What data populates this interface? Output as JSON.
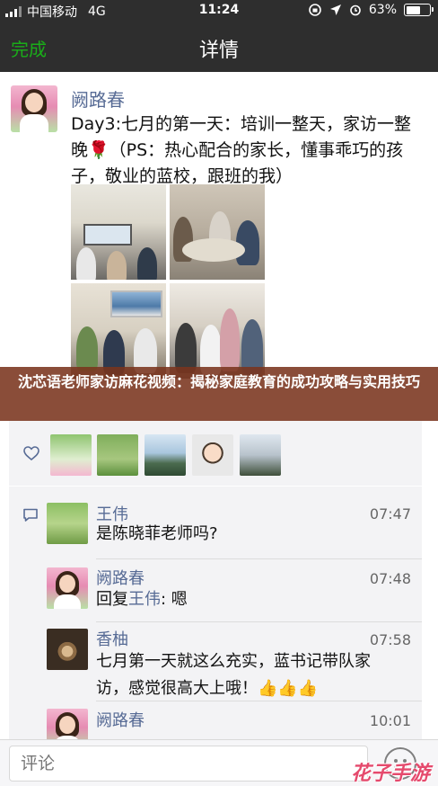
{
  "status_bar": {
    "carrier": "中国移动",
    "network": "4G",
    "time": "11:24",
    "battery_percent_label": "63%",
    "battery_level": 0.63
  },
  "nav": {
    "done_label": "完成",
    "title": "详情"
  },
  "post": {
    "author": "阙路春",
    "text": "Day3:七月的第一天：培训一整天，家访一整晚🌹（PS：热心配合的家长，懂事乖巧的孩子，敬业的蓝校，跟班的我）"
  },
  "banner": {
    "text": "沈芯语老师家访麻花视频：揭秘家庭教育的成功攻略与实用技巧"
  },
  "comments": [
    {
      "author": "王伟",
      "time": "07:47",
      "text": "是陈晓菲老师吗?"
    },
    {
      "author": "阙路春",
      "time": "07:48",
      "reply_prefix": "回复",
      "reply_to": "王伟",
      "text": ": 嗯"
    },
    {
      "author": "香柚",
      "time": "07:58",
      "text": "七月第一天就这么充实，蓝书记带队家访，感觉很高大上哦！👍👍👍"
    },
    {
      "author": "阙路春",
      "time": "10:01",
      "text": ""
    }
  ],
  "input": {
    "placeholder": "评论"
  },
  "watermark": "花子手游",
  "colors": {
    "bar_background": "#2e2e2e",
    "accent_green": "#1aad19",
    "name_blue": "#576b95",
    "banner_overlay": "#7a341e"
  },
  "icons": {
    "like": "heart-icon",
    "comment": "comment-icon",
    "emoji": "emoji-icon"
  }
}
